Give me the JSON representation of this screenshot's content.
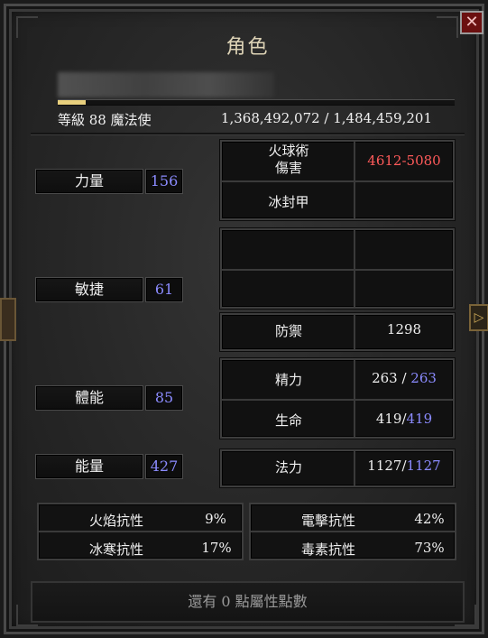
{
  "window": {
    "title": "角色",
    "close_glyph": "✕"
  },
  "character": {
    "name": "",
    "level_class": "等級 88 魔法使",
    "experience": "1,368,492,072 / 1,484,459,201",
    "xp_progress": 0.07
  },
  "attributes": [
    {
      "label": "力量",
      "value": "156"
    },
    {
      "label": "敏捷",
      "value": "61"
    },
    {
      "label": "體能",
      "value": "85"
    },
    {
      "label": "能量",
      "value": "427"
    }
  ],
  "skills": {
    "skill1_label": "火球術\n傷害",
    "skill1_value": "4612-5080",
    "skill2_label": "冰封甲",
    "skill2_value": ""
  },
  "defense": {
    "label": "防禦",
    "value": "1298"
  },
  "stamina": {
    "label": "精力",
    "current": "263",
    "sep": " / ",
    "max": "263"
  },
  "life": {
    "label": "生命",
    "current": "419",
    "sep": "/",
    "max": "419"
  },
  "mana": {
    "label": "法力",
    "current": "1127",
    "sep": "/",
    "max": "1127"
  },
  "resistances": [
    {
      "label": "火焰抗性",
      "value": "9%"
    },
    {
      "label": "電擊抗性",
      "value": "42%"
    },
    {
      "label": "冰寒抗性",
      "value": "17%"
    },
    {
      "label": "毒素抗性",
      "value": "73%"
    }
  ],
  "footer": {
    "text": "還有 0 點屬性點數"
  },
  "icons": {
    "side_arrow": "▷"
  },
  "colors": {
    "boosted_value": "#8b8bff",
    "damage": "#ff5a5a",
    "xp_bar": "#e9d07e"
  }
}
